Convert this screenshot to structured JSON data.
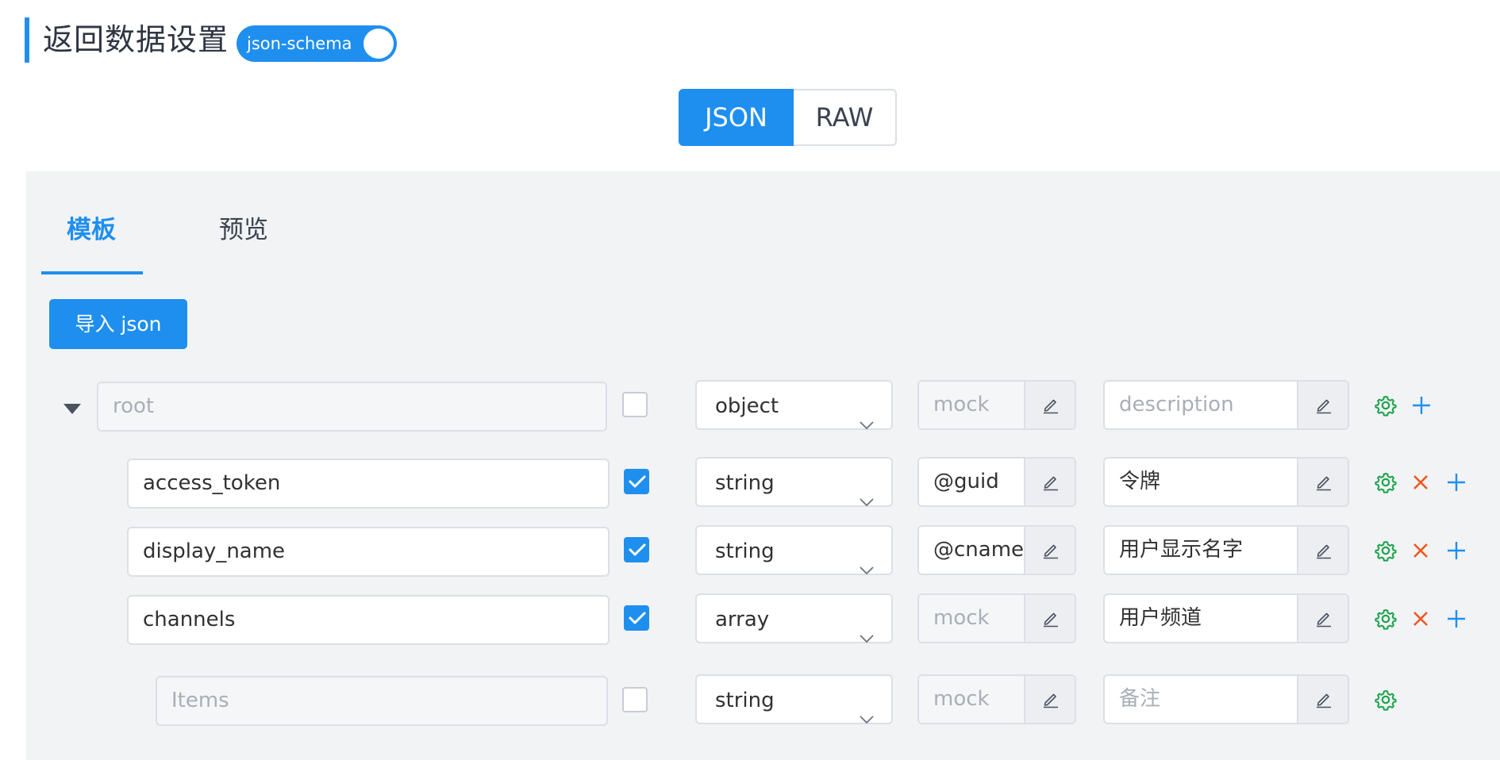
{
  "header": {
    "title": "返回数据设置",
    "schema_switch_label": "json-schema",
    "schema_switch_on": true
  },
  "format_toggle": {
    "options": [
      "JSON",
      "RAW"
    ],
    "selected": "JSON"
  },
  "tabs": [
    {
      "label": "模板",
      "active": true
    },
    {
      "label": "预览",
      "active": false
    }
  ],
  "import_button_label": "导入 json",
  "colors": {
    "accent": "#1f8fef",
    "settings_icon": "#1aa34a",
    "delete_icon": "#f0561d",
    "add_icon": "#1f8fef"
  },
  "rows": [
    {
      "name": "",
      "name_placeholder": "root",
      "expand_icon": "caret-down-icon",
      "required": false,
      "type": "object",
      "mock": "",
      "mock_placeholder": "mock",
      "mock_disabled": true,
      "description": "",
      "description_placeholder": "description"
    },
    {
      "name": "access_token",
      "required": true,
      "type": "string",
      "mock": "@guid",
      "mock_disabled": false,
      "description": "令牌"
    },
    {
      "name": "display_name",
      "required": true,
      "type": "string",
      "mock": "@cname",
      "mock_disabled": false,
      "description": "用户显示名字"
    },
    {
      "name": "channels",
      "required": true,
      "type": "array",
      "mock": "",
      "mock_placeholder": "mock",
      "mock_disabled": true,
      "description": "用户频道"
    },
    {
      "name": "",
      "name_placeholder": "Items",
      "required": false,
      "type": "string",
      "mock": "",
      "mock_placeholder": "mock",
      "mock_disabled": true,
      "description": "",
      "description_placeholder": "备注"
    }
  ],
  "icons": {
    "edit": "pencil-icon",
    "settings": "gear-icon",
    "delete": "close-icon",
    "add": "plus-icon",
    "dropdown": "chevron-down-icon"
  }
}
